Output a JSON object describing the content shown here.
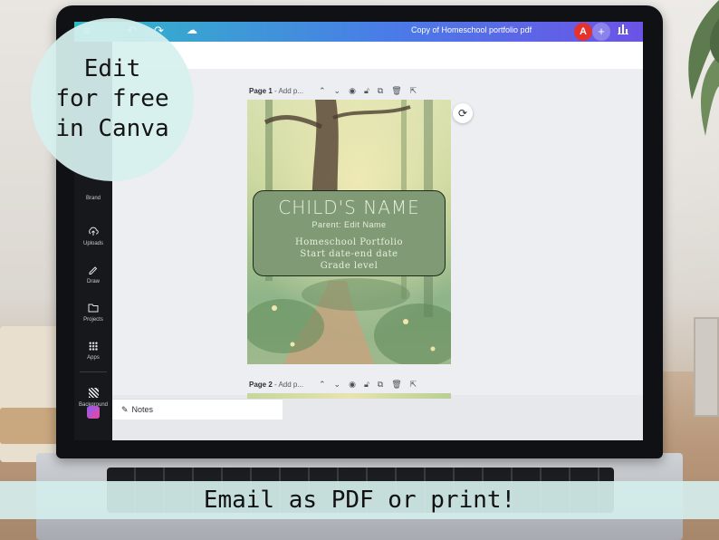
{
  "overlay": {
    "badge_text": "Edit\nfor free\nin Canva",
    "banner_text": "Email as PDF or print!"
  },
  "app": {
    "doc_title": "Copy of Homeschool portfolio pdf",
    "avatar_initial": "A",
    "plus_label": "+",
    "share_icon": "bar-chart-icon"
  },
  "sidebar": {
    "items": [
      {
        "label": "Brand",
        "icon": "brand-icon"
      },
      {
        "label": "Uploads",
        "icon": "cloud-upload-icon"
      },
      {
        "label": "Draw",
        "icon": "pen-icon"
      },
      {
        "label": "Projects",
        "icon": "folder-icon"
      },
      {
        "label": "Apps",
        "icon": "apps-grid-icon"
      },
      {
        "label": "Background",
        "icon": "background-icon"
      }
    ]
  },
  "pages": [
    {
      "label": "Page 1",
      "title_placeholder": "Add p..."
    },
    {
      "label": "Page 2",
      "title_placeholder": "Add p..."
    }
  ],
  "design": {
    "child_name": "CHILD'S NAME",
    "parent_line": "Parent: Edit Name",
    "line1": "Homeschool Portfolio",
    "line2": "Start date-end date",
    "line3": "Grade level"
  },
  "notes": {
    "label": "Notes"
  },
  "colors": {
    "topbar_start": "#2fb9c5",
    "topbar_end": "#6b53e6",
    "rail_bg": "#17181c",
    "name_box": "#7f9a74",
    "avatar": "#e5322d"
  }
}
